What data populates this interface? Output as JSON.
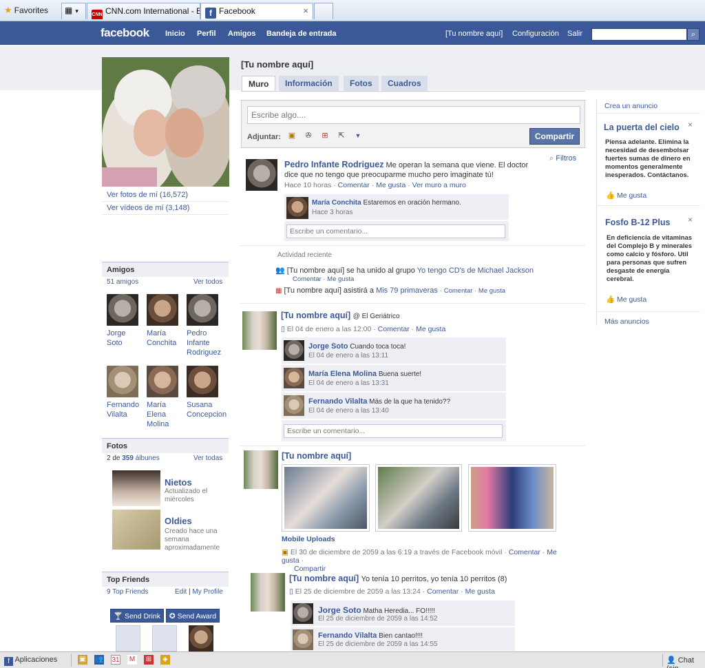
{
  "browser": {
    "favorites_label": "Favorites",
    "tabs": [
      {
        "label": "CNN.com International - B..."
      },
      {
        "label": "Facebook"
      }
    ],
    "tab_icon_cnn": "CNN",
    "tab_icon_fb": "f"
  },
  "fb_header": {
    "logo": "facebook",
    "nav": [
      "Inicio",
      "Perfil",
      "Amigos",
      "Bandeja de entrada"
    ],
    "user_link": "[Tu nombre aquí]",
    "settings": "Configuración",
    "logout": "Salir",
    "search_placeholder": ""
  },
  "profile": {
    "name": "[Tu nombre aquí]",
    "photos_link": "Ver fotos de mí (16,572)",
    "videos_link": "Ver vídeos de mí (3,148)"
  },
  "tabs": [
    "Muro",
    "Información",
    "Fotos",
    "Cuadros"
  ],
  "composer": {
    "placeholder": "Escribe algo....",
    "attach_label": "Adjuntar:",
    "share_button": "Compartir"
  },
  "filters": "Filtros",
  "friends": {
    "title": "Amigos",
    "count": "51 amigos",
    "see_all": "Ver todos",
    "items": [
      [
        "Jorge",
        "Soto"
      ],
      [
        "María",
        "Conchita"
      ],
      [
        "Pedro",
        "Infante",
        "Rodriguez"
      ],
      [
        "Fernando",
        "Vilalta"
      ],
      [
        "María",
        "Elena",
        "Molina"
      ],
      [
        "Susana",
        "Concepcion"
      ]
    ]
  },
  "photos_box": {
    "title": "Fotos",
    "count_prefix": "2 de",
    "count_num": "359",
    "count_suffix": "álbunes",
    "see_all": "Ver todas",
    "albums": [
      {
        "title": "Nietos",
        "desc": [
          "Actualizado el",
          "miércoles"
        ]
      },
      {
        "title": "Oldies",
        "desc": [
          "Creado hace una",
          "semana",
          "aproximadamente"
        ]
      }
    ]
  },
  "top_friends": {
    "title": "Top Friends",
    "count": "9 Top Friends",
    "edit": "Edit",
    "divider": "|",
    "my_profile": "My Profile",
    "send_drink": "Send Drink",
    "send_award": "Send Award"
  },
  "posts": {
    "p1": {
      "author": "Pedro Infante Rodriguez",
      "text1": "Me operan la semana que viene. El doctor",
      "text2": "dice que no tengo que preocuparme mucho pero imaginate tú!",
      "time": "Hace 10 horas",
      "comment": "Comentar",
      "like": "Me gusta",
      "wall": "Ver muro a muro",
      "dot": "·",
      "c1_author": "María Conchita",
      "c1_text": "Estaremos en oración hermano.",
      "c1_time": "Hace 3 horas",
      "comment_placeholder": "Escribe un comentario..."
    },
    "activity": {
      "title": "Actividad reciente",
      "a1_pre": "[Tu nombre aquí] se ha unido al grupo",
      "a1_link": "Yo tengo CD's de Michael Jackson",
      "a1_comment": "Comentar",
      "a1_like": "Me gusta",
      "a2_pre": "[Tu nombre aquí] asistirá a",
      "a2_link": "Mis 79 primaveras",
      "a2_comment": "Comentar",
      "a2_like": "Me gusta",
      "dot": "·"
    },
    "p2": {
      "author": "[Tu nombre aquí]",
      "at": "@ El Geriátrico",
      "time": "El 04 de enero a las 12:00",
      "comment": "Comentar",
      "like": "Me gusta",
      "dot": "·",
      "c1_author": "Jorge Soto",
      "c1_text": "Cuando toca toca!",
      "c1_time": "El 04 de enero a las 13:11",
      "c2_author": "María Elena Molina",
      "c2_text": "Buena suerte!",
      "c2_time": "El 04 de enero a las 13:31",
      "c3_author": "Fernando Vilalta",
      "c3_text": "Más de la que ha tenido??",
      "c3_time": "El 04 de enero a las 13:40",
      "comment_placeholder": "Escribe un comentario..."
    },
    "p3": {
      "author": "[Tu nombre aquí]",
      "album": "Mobile Uploads",
      "time": "El 30 de diciembre de 2059 a las 6:19 a través de Facebook móvil",
      "comment": "Comentar",
      "like": "Me gusta",
      "share": "Compartir",
      "dot": "·"
    },
    "p4": {
      "author": "[Tu nombre aquí]",
      "text": "Yo tenía 10 perritos, yo tenía 10 perritos (8)",
      "time": "El 25 de diciembre de 2059 a las 13:24",
      "comment": "Comentar",
      "like": "Me gusta",
      "dot": "·",
      "c1_author": "Jorge Soto",
      "c1_text": "Matha Heredia... FO!!!!!",
      "c1_time": "El 25 de diciembre de 2059 a las 14:52",
      "c2_author": "Fernando Vilalta",
      "c2_text": "Bien cantao!!!!",
      "c2_time": "El 25 de diciembre de 2059 a las 14:55"
    }
  },
  "right": {
    "create_ad": "Crea un anuncio",
    "ad1_title": "La puerta del cielo",
    "ad1_body": [
      "Piensa adelante. Elimina la",
      "necesidad de desembolsar",
      "fuertes sumas de dinero en",
      "momentos generalmente",
      "inesperados. Contáctanos."
    ],
    "ad1_like": "Me gusta",
    "ad2_title": "Fosfo B-12 Plus",
    "ad2_body": [
      "En deficiencia de vitaminas",
      "del Complejo B y minerales",
      "como calcio y fósforo. Util",
      "para personas que sufren",
      "desgaste de energía",
      "cerebral."
    ],
    "ad2_like": "Me gusta",
    "more_ads": "Más anuncios",
    "close": "×"
  },
  "bottom": {
    "apps": "Aplicaciones",
    "chat": "Chat (sin"
  },
  "colors": {
    "fb_blue": "#3b5998",
    "header_dark": "#29447e",
    "light_panel": "#edeff4"
  }
}
